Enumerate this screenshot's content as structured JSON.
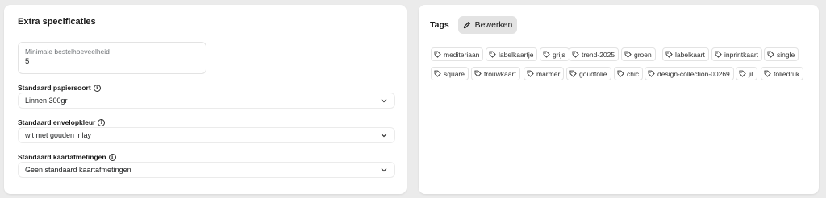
{
  "specs": {
    "title": "Extra specificaties",
    "min_qty": {
      "label": "Minimale bestelhoeveelheid",
      "value": "5"
    },
    "paper": {
      "label": "Standaard papiersoort",
      "value": "Linnen 300gr"
    },
    "envelope": {
      "label": "Standaard envelopkleur",
      "value": "wit met gouden inlay"
    },
    "size": {
      "label": "Standaard kaartafmetingen",
      "value": "Geen standaard kaartafmetingen"
    }
  },
  "tags": {
    "title": "Tags",
    "edit_label": "Bewerken",
    "items": [
      "mediteriaan",
      "labelkaartje",
      "grijs",
      "trend-2025",
      "groen",
      "labelkaart",
      "inprintkaart",
      "single",
      "square",
      "trouwkaart",
      "marmer",
      "goudfolie",
      "chic",
      "design-collection-00269",
      "jil",
      "foliedruk"
    ]
  }
}
